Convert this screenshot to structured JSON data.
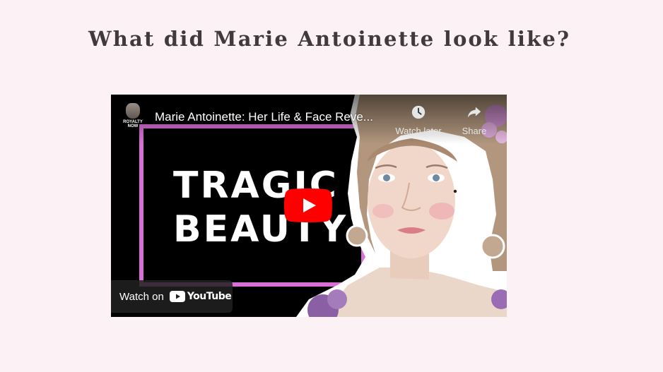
{
  "page": {
    "heading": "What did Marie Antoinette look like?"
  },
  "video": {
    "channel_name": "ROYALTY NOW",
    "title": "Marie Antoinette: Her Life & Face Reve...",
    "thumbnail_text_line1": "TRAGIC",
    "thumbnail_text_line2": "BEAUTY",
    "actions": {
      "watch_later": "Watch later",
      "share": "Share"
    },
    "watch_on_label": "Watch on",
    "platform_name": "YouTube",
    "icons": {
      "watch_later": "clock-icon",
      "share": "share-icon",
      "play": "play-icon",
      "platform": "youtube-logo-icon"
    },
    "colors": {
      "frame_border": "#d96fd6",
      "play_button": "#ff0000",
      "background": "#fcf1f5"
    }
  }
}
